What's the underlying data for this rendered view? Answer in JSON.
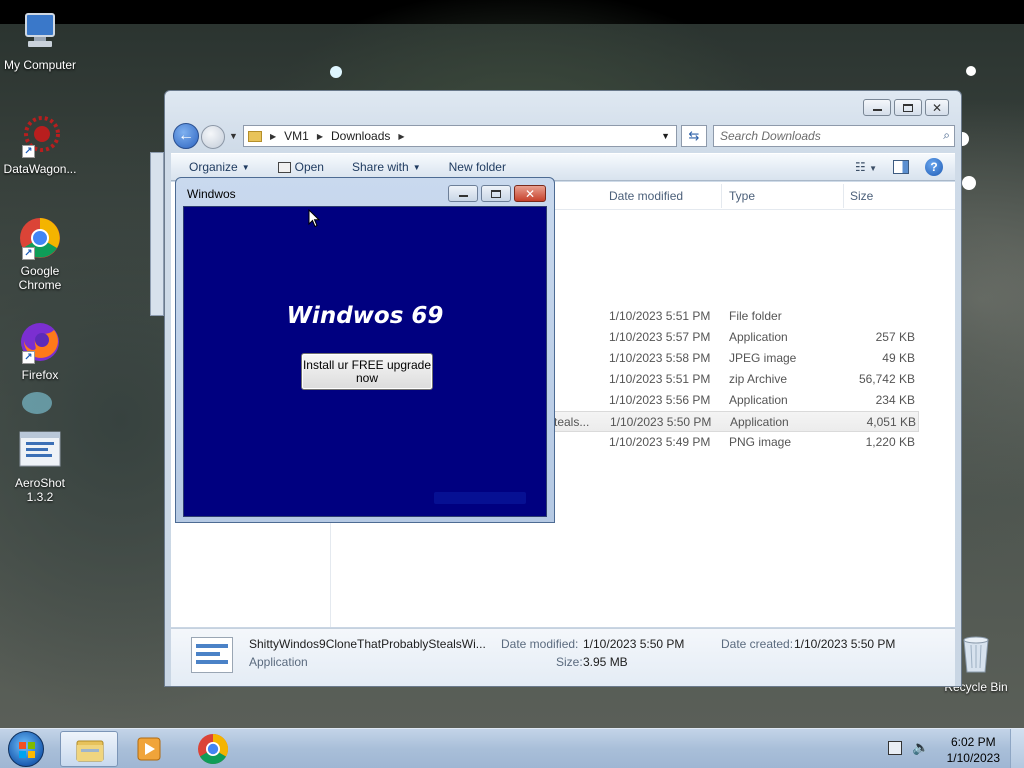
{
  "desktop": {
    "icons": [
      {
        "label": "My Computer",
        "icon": "computer-icon"
      },
      {
        "label": "DataWagon...",
        "icon": "datawagon-icon"
      },
      {
        "label": "Google Chrome",
        "icon": "chrome-icon"
      },
      {
        "label": "Firefox",
        "icon": "firefox-icon"
      },
      {
        "label": "AeroShot 1.3.2",
        "icon": "aeroshot-icon"
      },
      {
        "label": "Recycle Bin",
        "icon": "recycle-bin-icon"
      }
    ]
  },
  "explorer": {
    "breadcrumb": [
      "VM1",
      "Downloads"
    ],
    "search_placeholder": "Search Downloads",
    "commands": {
      "organize": "Organize",
      "open": "Open",
      "share_with": "Share with",
      "new_folder": "New folder"
    },
    "columns": {
      "date_modified": "Date modified",
      "type": "Type",
      "size": "Size"
    },
    "rows": [
      {
        "name": "",
        "date": "1/10/2023 5:51 PM",
        "type": "File folder",
        "size": "",
        "selected": false
      },
      {
        "name": "",
        "date": "1/10/2023 5:57 PM",
        "type": "Application",
        "size": "257 KB",
        "selected": false
      },
      {
        "name": "",
        "date": "1/10/2023 5:58 PM",
        "type": "JPEG image",
        "size": "49 KB",
        "selected": false
      },
      {
        "name": "",
        "date": "1/10/2023 5:51 PM",
        "type": "zip Archive",
        "size": "56,742 KB",
        "selected": false
      },
      {
        "name": "",
        "date": "1/10/2023 5:56 PM",
        "type": "Application",
        "size": "234 KB",
        "selected": false
      },
      {
        "name": "teals...",
        "date": "1/10/2023 5:50 PM",
        "type": "Application",
        "size": "4,051 KB",
        "selected": true
      },
      {
        "name": "",
        "date": "1/10/2023 5:49 PM",
        "type": "PNG image",
        "size": "1,220 KB",
        "selected": false
      }
    ],
    "details": {
      "filename": "ShittyWindos9CloneThatProbablyStealsWi...",
      "filetype": "Application",
      "date_modified_label": "Date modified:",
      "date_modified": "1/10/2023 5:50 PM",
      "date_created_label": "Date created:",
      "date_created": "1/10/2023 5:50 PM",
      "size_label": "Size:",
      "size": "3.95 MB"
    }
  },
  "dialog": {
    "title": "Windwos",
    "heading": "Windwos 69",
    "button_label": "Install ur FREE upgrade now"
  },
  "taskbar": {
    "time": "6:02 PM",
    "date": "1/10/2023",
    "pinned": [
      "explorer-icon",
      "media-player-icon",
      "chrome-icon"
    ]
  }
}
